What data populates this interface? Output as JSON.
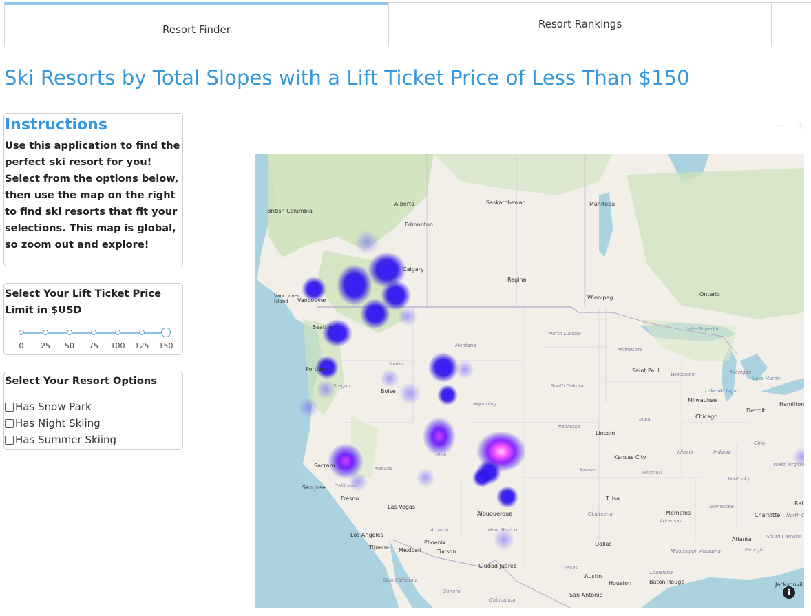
{
  "tabs": [
    {
      "label": "Resort Finder",
      "active": true
    },
    {
      "label": "Resort Rankings",
      "active": false
    }
  ],
  "page_title": "Ski Resorts by Total Slopes with a Lift Ticket Price of Less Than $150",
  "instructions": {
    "heading": "Instructions",
    "body": "Use this application to find the perfect ski resort for you! Select from the options below, then use the map on the right to find ski resorts that fit your selections. This map is global, so zoom out and explore!"
  },
  "price_filter": {
    "label": "Select Your Lift Ticket Price Limit in $USD",
    "marks": [
      "0",
      "25",
      "50",
      "75",
      "100",
      "125",
      "150"
    ],
    "selected_value": 150
  },
  "resort_options": {
    "label": "Select Your Resort Options",
    "options": [
      "Has Snow Park",
      "Has Night Skiing",
      "Has Summer Skiing"
    ]
  },
  "map": {
    "info_icon": "info-icon",
    "labels": {
      "british_columbia": "British Columbia",
      "alberta": "Alberta",
      "saskatchewan": "Saskatchewan",
      "manitoba": "Manitoba",
      "ontario": "Ontario",
      "edmonton": "Edmonton",
      "calgary": "Calgary",
      "regina": "Regina",
      "winnipeg": "Winnipeg",
      "vancouver_island": "Vancouver Island",
      "vancouver": "Vancouver",
      "seattle": "Seattle",
      "portland": "Portland",
      "oregon": "Oregon",
      "idaho": "Idaho",
      "boise": "Boise",
      "montana": "Montana",
      "north_dakota": "North Dakota",
      "south_dakota": "South Dakota",
      "minnesota": "Minnesota",
      "saint_paul": "Saint Paul",
      "wisconsin": "Wisconsin",
      "michigan": "Michigan",
      "lake_superior": "Lake Superior",
      "lake_michigan": "Lake Michigan",
      "lake_huron": "Lake Huron",
      "milwaukee": "Milwaukee",
      "detroit": "Detroit",
      "hamilton": "Hamilton",
      "chicago": "Chicago",
      "wyoming": "Wyoming",
      "iowa": "Iowa",
      "nebraska": "Nebraska",
      "lincoln": "Lincoln",
      "sacramento": "Sacram",
      "nevada": "Nevada",
      "utah": "Utah",
      "san_jose": "San Jose",
      "california": "California",
      "fresno": "Fresno",
      "kansas_city": "Kansas City",
      "illinois": "Illinois",
      "indiana": "Indiana",
      "ohio": "Ohio",
      "west_virginia": "West Virginia",
      "kansas": "Kansas",
      "missouri": "Missouri",
      "kentucky": "Kentucky",
      "las_vegas": "Las Vegas",
      "albuquerque": "Albuquerque",
      "tulsa": "Tulsa",
      "oklahoma": "Oklahoma",
      "memphis": "Memphis",
      "tennessee": "Tennessee",
      "charlotte": "Charlotte",
      "raleigh": "Ral",
      "north_carolina": "North C",
      "arkansas": "Arkansas",
      "los_angeles": "Los Angeles",
      "arizona": "Arizona",
      "new_mexico": "New Mexico",
      "atlanta": "Atlanta",
      "south_carolina": "South Carolina",
      "tijuana": "Tijuana",
      "mexicali": "Mexicali",
      "phoenix": "Phoenix",
      "tucson": "Tucson",
      "dallas": "Dallas",
      "mississippi": "Mississippi",
      "alabama": "Alabama",
      "georgia": "Georgia",
      "ciudad_juarez": "Ciudad Juárez",
      "texas": "Texas",
      "louisiana": "Louisiana",
      "austin": "Austin",
      "houston": "Houston",
      "baton_rouge": "Baton Rouge",
      "jacksonville": "Jacksonville",
      "baja_california": "Baja California",
      "sonora": "Sonora",
      "chihuahua": "Chihuahua",
      "san_antonio": "San Antonio"
    }
  },
  "colors": {
    "accent": "#3498db",
    "heat_low": "#2b1aff",
    "heat_high": "#ff6bff"
  }
}
